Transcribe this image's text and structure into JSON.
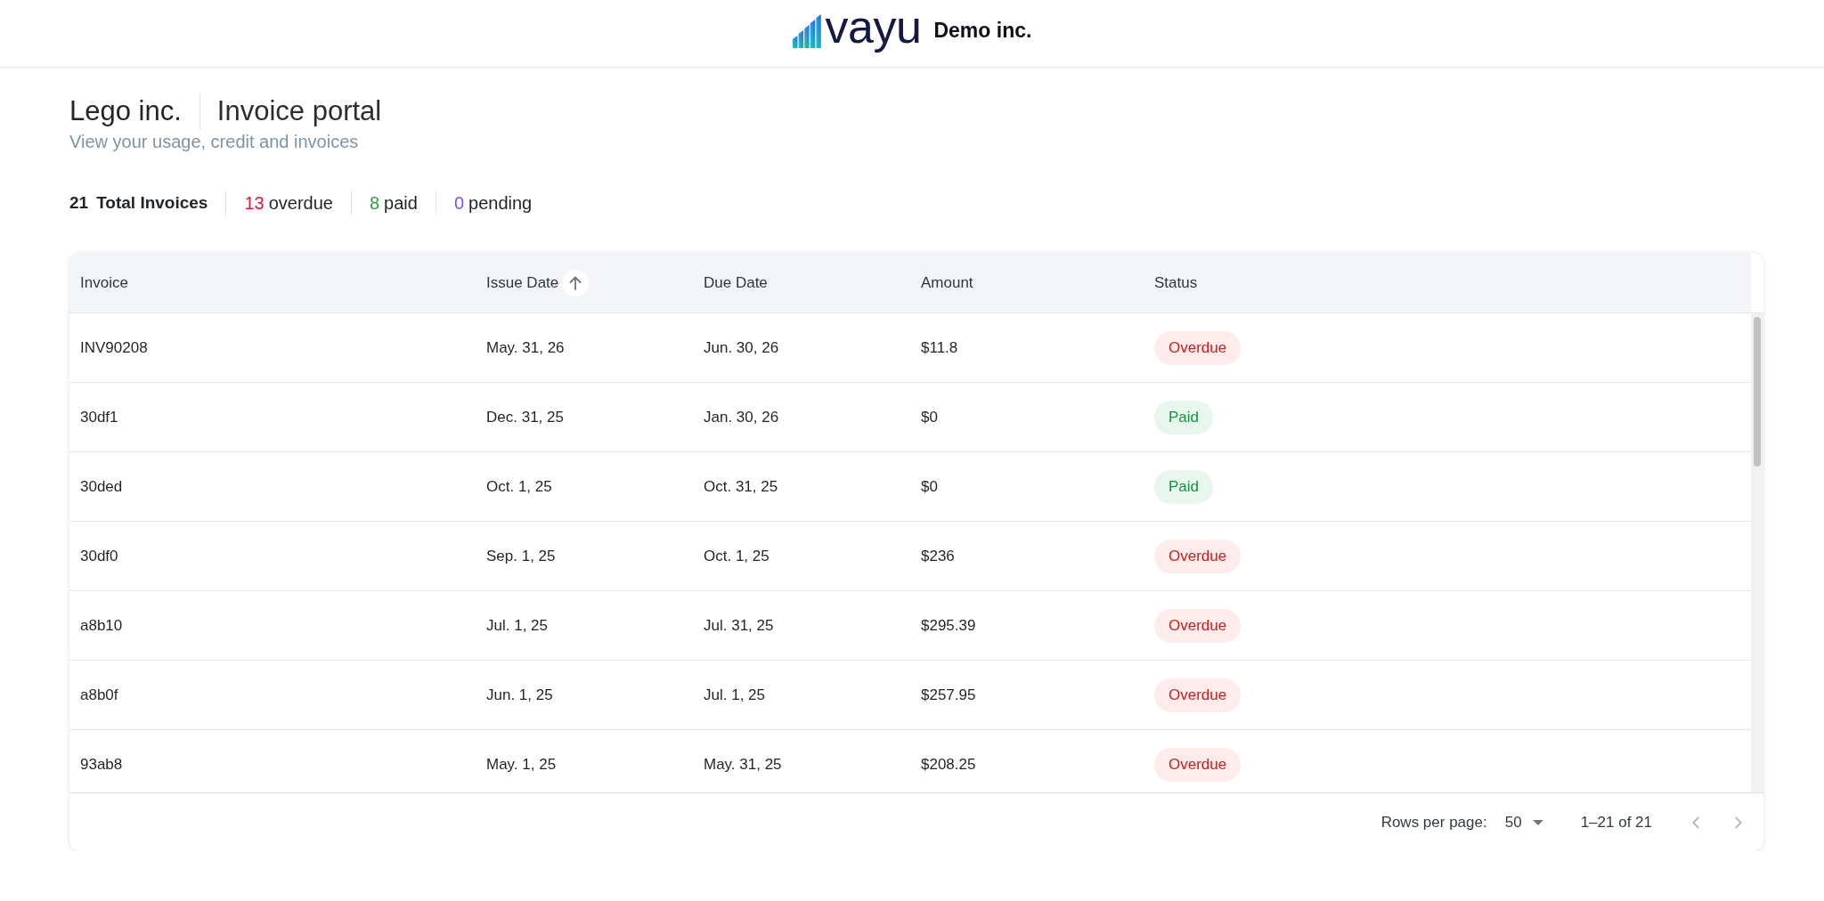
{
  "header": {
    "logo_text": "vayu",
    "company": "Demo inc."
  },
  "page": {
    "customer": "Lego inc.",
    "title": "Invoice portal",
    "subtitle": "View your usage, credit and invoices"
  },
  "stats": [
    {
      "kind": "total",
      "count": "21",
      "label": "Total Invoices",
      "color": "#1f2329"
    },
    {
      "kind": "status",
      "count": "13",
      "label": "overdue",
      "color": "#e8173f"
    },
    {
      "kind": "status",
      "count": "8",
      "label": "paid",
      "color": "#33a047"
    },
    {
      "kind": "status",
      "count": "0",
      "label": "pending",
      "color": "#7b4dff"
    }
  ],
  "table": {
    "columns": [
      {
        "label": "Invoice",
        "sorted": false
      },
      {
        "label": "Issue Date",
        "sorted": true
      },
      {
        "label": "Due Date",
        "sorted": false
      },
      {
        "label": "Amount",
        "sorted": false
      },
      {
        "label": "Status",
        "sorted": false
      }
    ],
    "rows": [
      {
        "invoice": "INV90208",
        "issue_date": "May. 31, 26",
        "due_date": "Jun. 30, 26",
        "amount": "$11.8",
        "status": {
          "label": "Overdue",
          "kind": "overdue"
        }
      },
      {
        "invoice": "30df1",
        "issue_date": "Dec. 31, 25",
        "due_date": "Jan. 30, 26",
        "amount": "$0",
        "status": {
          "label": "Paid",
          "kind": "paid"
        }
      },
      {
        "invoice": "30ded",
        "issue_date": "Oct. 1, 25",
        "due_date": "Oct. 31, 25",
        "amount": "$0",
        "status": {
          "label": "Paid",
          "kind": "paid"
        }
      },
      {
        "invoice": "30df0",
        "issue_date": "Sep. 1, 25",
        "due_date": "Oct. 1, 25",
        "amount": "$236",
        "status": {
          "label": "Overdue",
          "kind": "overdue"
        }
      },
      {
        "invoice": "a8b10",
        "issue_date": "Jul. 1, 25",
        "due_date": "Jul. 31, 25",
        "amount": "$295.39",
        "status": {
          "label": "Overdue",
          "kind": "overdue"
        }
      },
      {
        "invoice": "a8b0f",
        "issue_date": "Jun. 1, 25",
        "due_date": "Jul. 1, 25",
        "amount": "$257.95",
        "status": {
          "label": "Overdue",
          "kind": "overdue"
        }
      },
      {
        "invoice": "93ab8",
        "issue_date": "May. 1, 25",
        "due_date": "May. 31, 25",
        "amount": "$208.25",
        "status": {
          "label": "Overdue",
          "kind": "overdue"
        }
      }
    ]
  },
  "pagination": {
    "rows_per_page_label": "Rows per page:",
    "rows_per_page": "50",
    "range": "1–21 of 21",
    "previous": {
      "disabled": true
    },
    "next": {
      "disabled": true
    }
  }
}
